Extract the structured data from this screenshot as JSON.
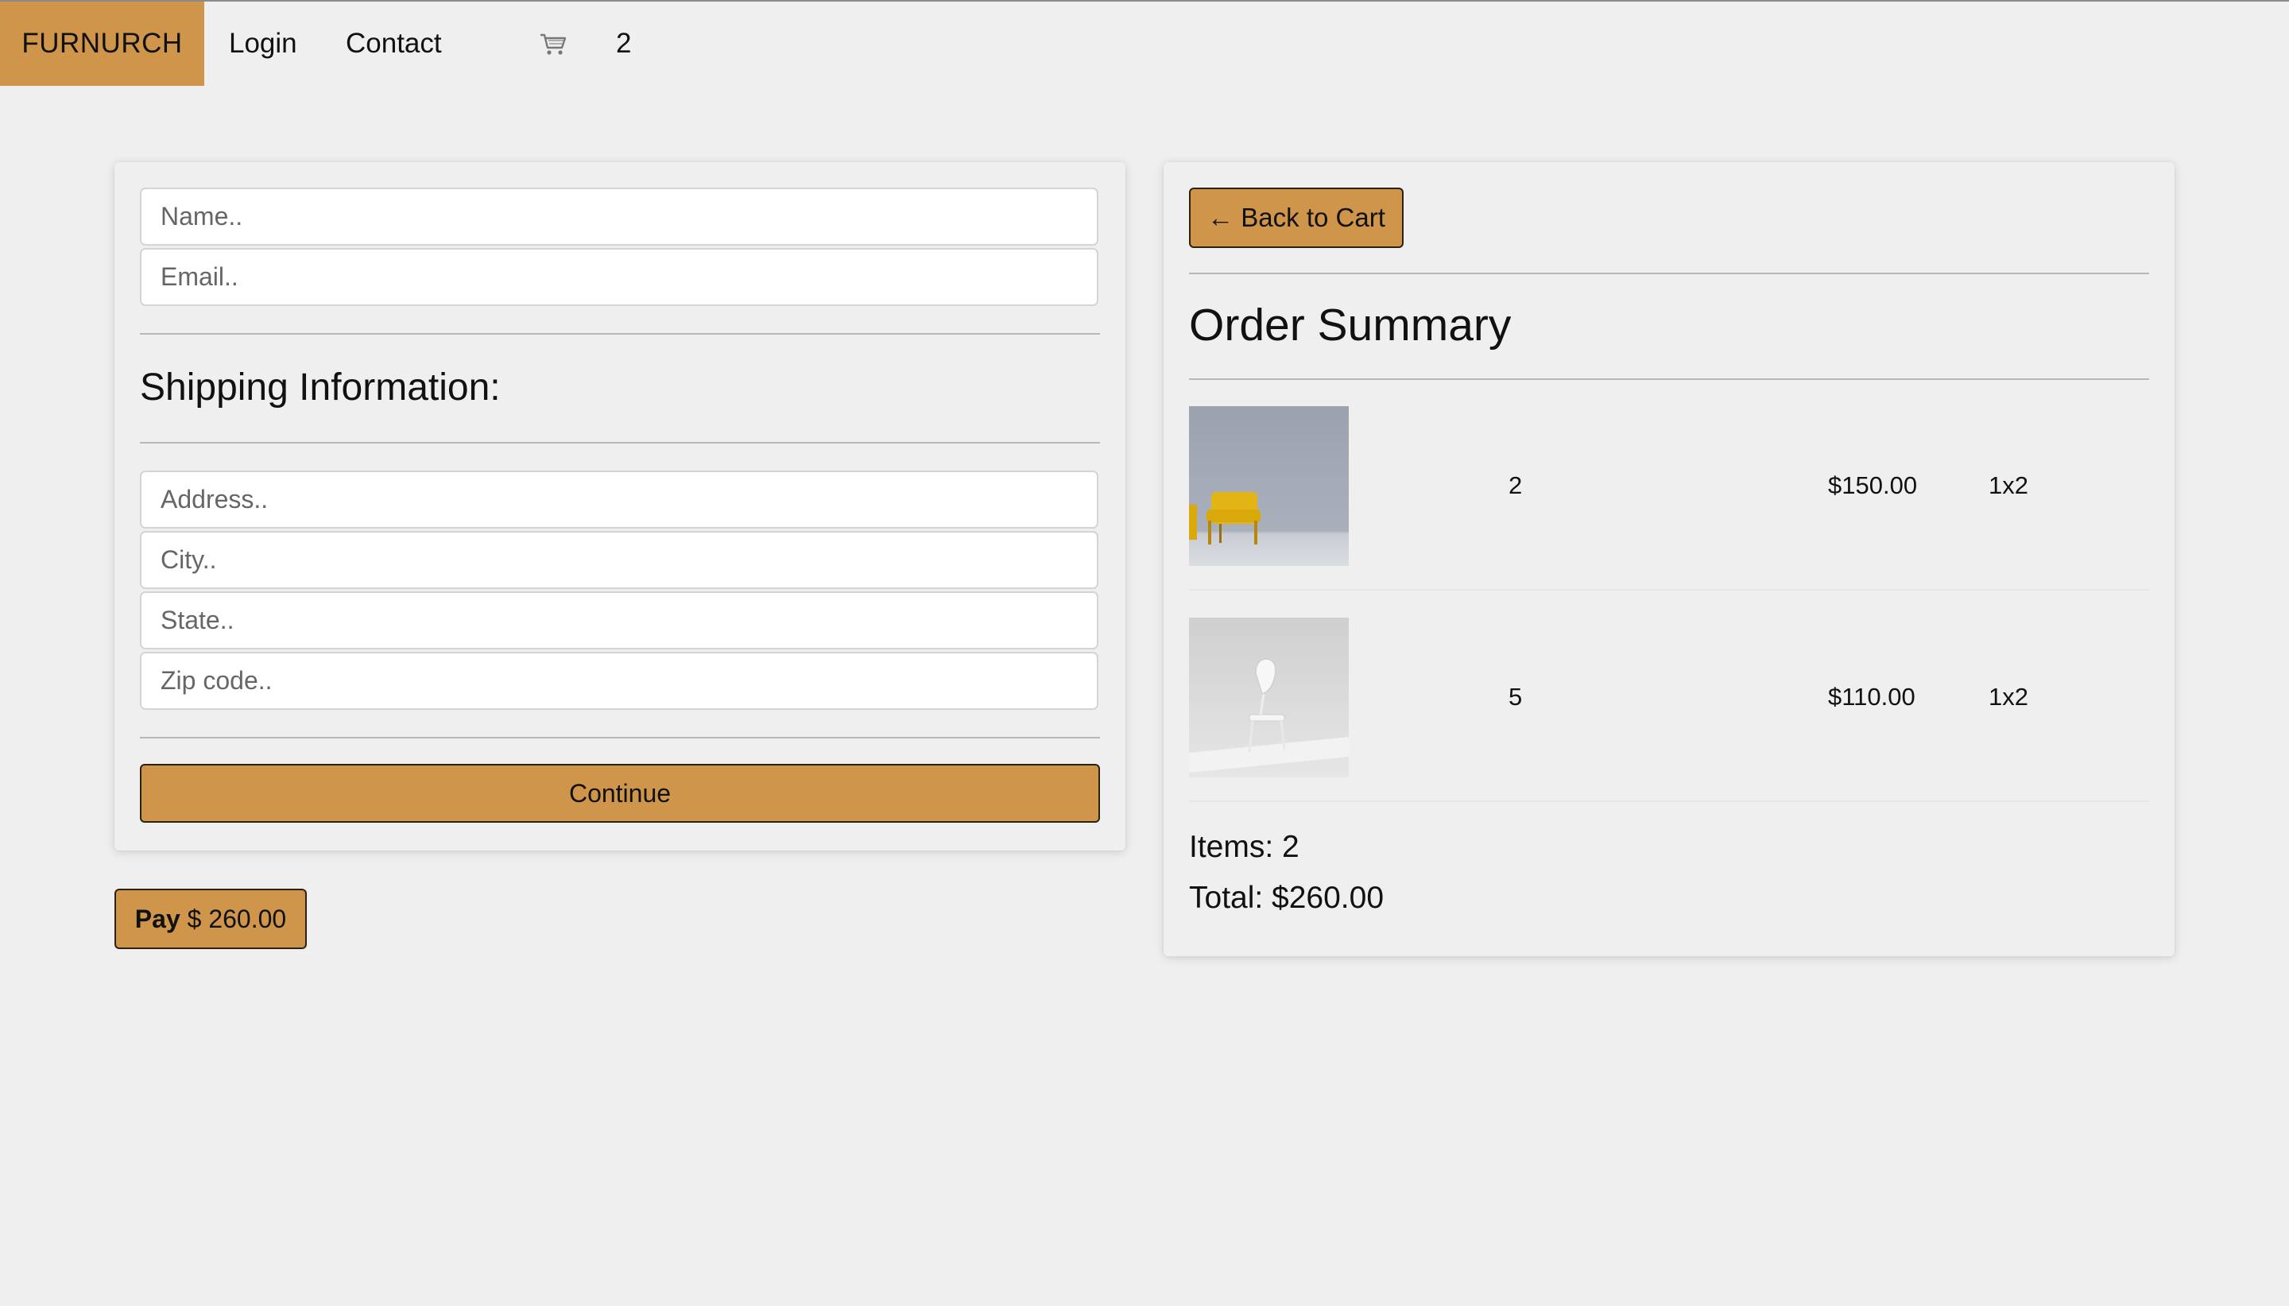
{
  "nav": {
    "brand": "FURNURCH",
    "login": "Login",
    "contact": "Contact",
    "cart_icon": "cart-icon",
    "cart_count": "2"
  },
  "form": {
    "name_placeholder": "Name..",
    "email_placeholder": "Email..",
    "shipping_title": "Shipping Information:",
    "address_placeholder": "Address..",
    "city_placeholder": "City..",
    "state_placeholder": "State..",
    "zip_placeholder": "Zip code..",
    "continue_label": "Continue"
  },
  "pay": {
    "label_bold": "Pay",
    "amount": "$ 260.00"
  },
  "summary": {
    "back_label": "← Back to Cart",
    "title": "Order Summary",
    "items": [
      {
        "image": "yellow-armchair-image",
        "qty": "2",
        "price": "$150.00",
        "dims": "1x2"
      },
      {
        "image": "white-chair-image",
        "qty": "5",
        "price": "$110.00",
        "dims": "1x2"
      }
    ],
    "items_label": "Items: 2",
    "total_label": "Total: $260.00"
  },
  "colors": {
    "accent": "#cf954a",
    "background": "#efefef"
  }
}
